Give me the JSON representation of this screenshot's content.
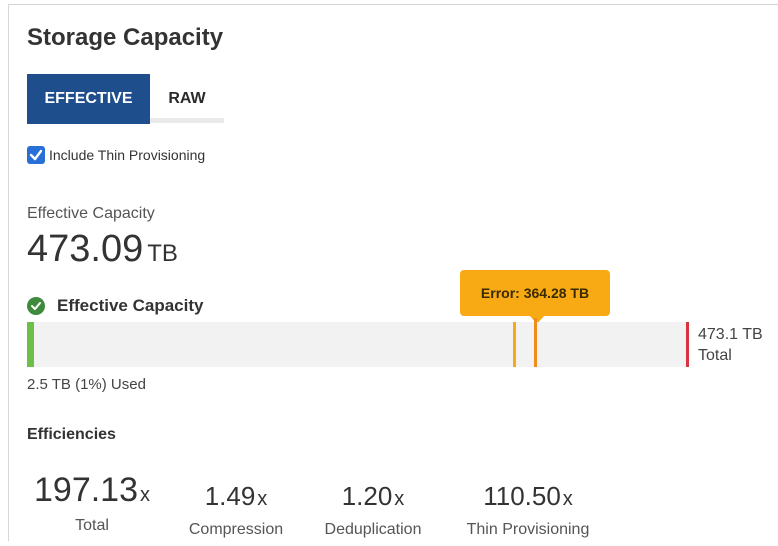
{
  "title": "Storage Capacity",
  "tabs": {
    "effective": "EFFECTIVE",
    "raw": "RAW",
    "active": "EFFECTIVE"
  },
  "include_thin": {
    "label": "Include Thin Provisioning",
    "checked": true
  },
  "capacity": {
    "label": "Effective Capacity",
    "value": "473.09",
    "unit": "TB"
  },
  "bar": {
    "header": "Effective Capacity",
    "tooltip": "Error: 364.28 TB",
    "total_value": "473.1 TB",
    "total_word": "Total",
    "used": "2.5 TB (1%) Used"
  },
  "efficiencies": {
    "heading": "Efficiencies",
    "items": [
      {
        "value": "197.13",
        "suffix": "x",
        "label": "Total"
      },
      {
        "value": "1.49",
        "suffix": "x",
        "label": "Compression"
      },
      {
        "value": "1.20",
        "suffix": "x",
        "label": "Deduplication"
      },
      {
        "value": "110.50",
        "suffix": "x",
        "label": "Thin Provisioning"
      }
    ]
  },
  "colors": {
    "tab_active": "#1e4e8c",
    "used": "#6cc04a",
    "warning": "#f7aa14",
    "total_marker": "#d9333f",
    "ok_icon": "#3f8a3c"
  }
}
